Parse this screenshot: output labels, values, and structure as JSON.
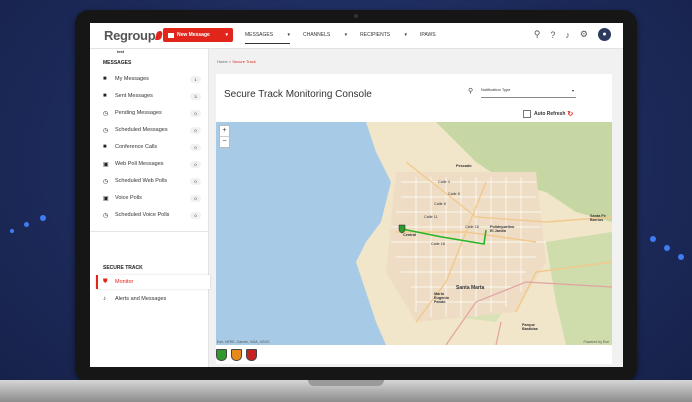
{
  "topnav": {
    "logo": "Regroup",
    "tenant": "test",
    "new_message_label": "New Message",
    "menu": [
      "MESSAGES",
      "CHANNELS",
      "RECIPIENTS",
      "IPAWS"
    ]
  },
  "sidebar": {
    "messages_heading": "MESSAGES",
    "items": [
      {
        "label": "My Messages",
        "count": "1"
      },
      {
        "label": "Sent Messages",
        "count": "3"
      },
      {
        "label": "Pending Messages",
        "count": "0"
      },
      {
        "label": "Scheduled Messages",
        "count": "0"
      },
      {
        "label": "Conference Calls",
        "count": "0"
      },
      {
        "label": "Web Poll Messages",
        "count": "0"
      },
      {
        "label": "Scheduled Web Polls",
        "count": "0"
      },
      {
        "label": "Voice Polls",
        "count": "0"
      },
      {
        "label": "Scheduled Voice Polls",
        "count": "0"
      }
    ],
    "secure_heading": "SECURE TRACK",
    "secure_items": [
      {
        "label": "Monitor"
      },
      {
        "label": "Alerts and Messages"
      }
    ]
  },
  "main": {
    "breadcrumb_home": "Home",
    "breadcrumb_sep": ">",
    "breadcrumb_current": "Secure Track",
    "title": "Secure Track Monitoring Console",
    "filter_placeholder": "Notification Type",
    "auto_refresh_label": "Auto Refresh"
  },
  "map": {
    "zoom_in": "+",
    "zoom_out": "−",
    "attribution": "Esri, HERE, Garmin, NGA, USGS",
    "powered": "Powered by Esri",
    "labels": [
      "Pescado",
      "Calle 4",
      "Calle 5",
      "Calle 8",
      "Calle 11",
      "Calle 16",
      "Calle 18",
      "Polideportivo El Jardín",
      "Central",
      "Santa Fe Barrios",
      "Santa Marta",
      "Mario Eugenio Pando",
      "Parque Bastidas"
    ]
  },
  "legend": {
    "shields": [
      "#2e9a2e",
      "#e8891c",
      "#c62424"
    ]
  },
  "colors": {
    "accent": "#e1251b",
    "route": "#27b524"
  }
}
